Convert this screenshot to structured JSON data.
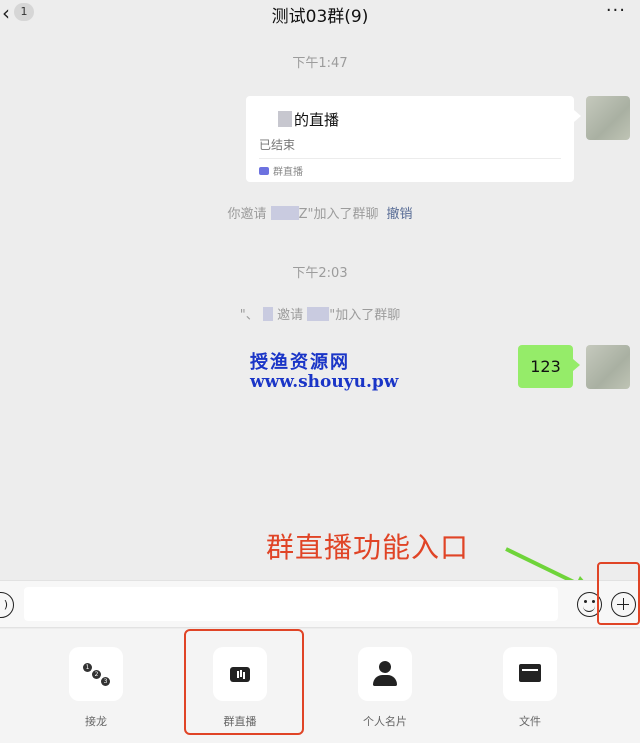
{
  "header": {
    "back_icon": "chevron-left-icon",
    "unread_count": "1",
    "title": "测试03群(9)",
    "more_icon": "ellipsis-icon"
  },
  "messages": {
    "time1": "下午1:47",
    "live_card": {
      "title": "的直播",
      "status": "已结束",
      "source": "群直播"
    },
    "system1": {
      "prefix": "你邀请",
      "suffix": "Z\"加入了群聊",
      "action": "撤销"
    },
    "time2": "下午2:03",
    "system2": {
      "prefix": "\"、",
      "middle": "邀请",
      "suffix": "\"加入了群聊"
    },
    "text_bubble": "123"
  },
  "watermark": {
    "name": "授渔资源网",
    "url": "www.shouyu.pw"
  },
  "annotation": {
    "text": "群直播功能入口",
    "color": "#e04426"
  },
  "input_bar": {
    "voice_icon": "voice-icon",
    "emoji_icon": "emoji-icon",
    "plus_icon": "plus-circle-icon"
  },
  "panel": {
    "items": [
      {
        "label": "接龙",
        "icon": "jielong-icon"
      },
      {
        "label": "群直播",
        "icon": "live-icon"
      },
      {
        "label": "个人名片",
        "icon": "person-card-icon"
      },
      {
        "label": "文件",
        "icon": "folder-icon"
      }
    ]
  },
  "colors": {
    "bubble_green": "#95ec69",
    "link_blue": "#576b95",
    "highlight_red": "#e04426",
    "watermark_blue": "#1a35c7"
  }
}
